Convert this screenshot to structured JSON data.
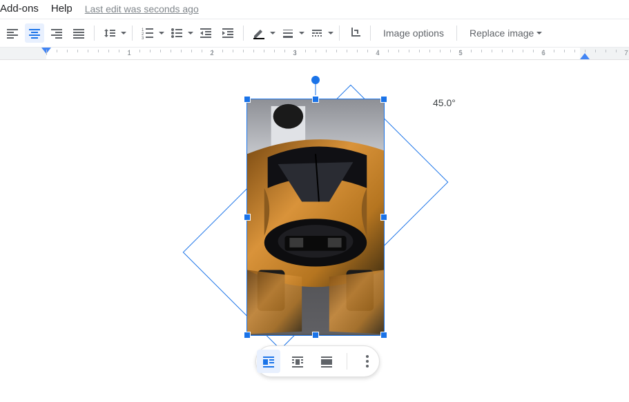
{
  "menubar": {
    "addons": "Add-ons",
    "help": "Help",
    "edit_status": "Last edit was seconds ago"
  },
  "toolbar": {
    "image_options": "Image options",
    "replace_image": "Replace image"
  },
  "ruler": {
    "labels": [
      "1",
      "2",
      "3",
      "4",
      "5",
      "6",
      "7"
    ]
  },
  "rotation": {
    "angle_text": "45.0°",
    "angle_deg": 45.0
  },
  "image": {
    "alt": "car-photo"
  }
}
